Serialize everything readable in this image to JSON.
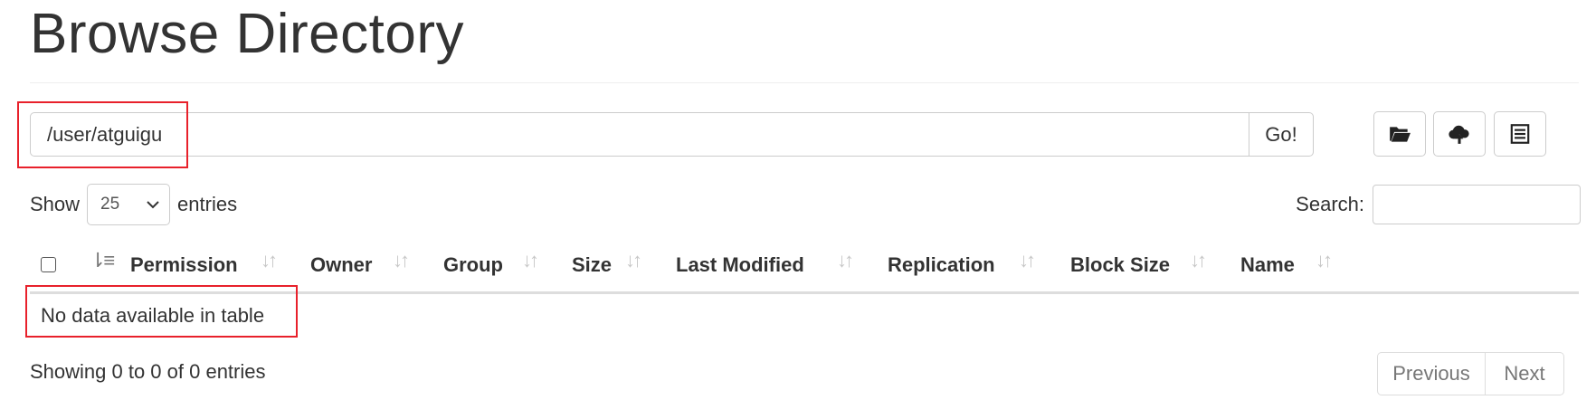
{
  "page": {
    "title": "Browse Directory"
  },
  "path_bar": {
    "value": "/user/atguigu",
    "go_label": "Go!"
  },
  "toolbar": {
    "icons": [
      "folder-open-icon",
      "cloud-upload-icon",
      "list-icon"
    ]
  },
  "table_controls": {
    "show_label": "Show",
    "page_length": "25",
    "entries_label": "entries",
    "search_label": "Search:",
    "search_value": ""
  },
  "table": {
    "columns": [
      "Permission",
      "Owner",
      "Group",
      "Size",
      "Last Modified",
      "Replication",
      "Block Size",
      "Name"
    ],
    "empty_message": "No data available in table"
  },
  "footer": {
    "info": "Showing 0 to 0 of 0 entries",
    "previous_label": "Previous",
    "next_label": "Next"
  },
  "colors": {
    "annotation": "#e8212b",
    "border": "#cccccc",
    "muted": "#777777"
  }
}
